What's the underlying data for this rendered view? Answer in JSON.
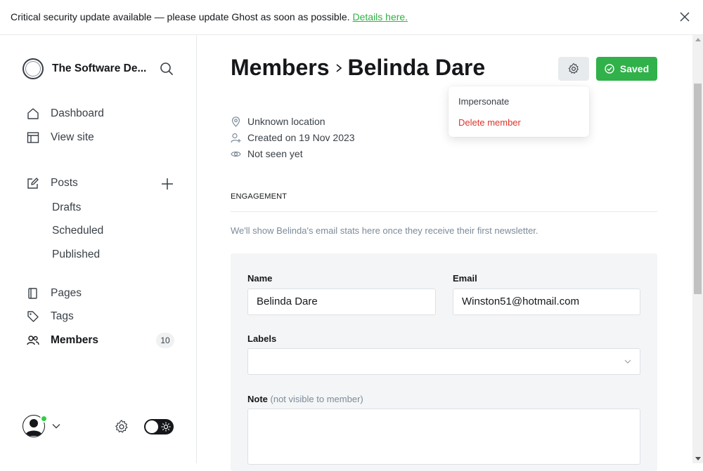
{
  "banner": {
    "text": "Critical security update available — please update Ghost as soon as possible.",
    "link": "Details here."
  },
  "sidebar": {
    "site_name": "The Software De...",
    "items": {
      "dashboard": "Dashboard",
      "view_site": "View site",
      "posts": "Posts",
      "drafts": "Drafts",
      "scheduled": "Scheduled",
      "published": "Published",
      "pages": "Pages",
      "tags": "Tags",
      "members": "Members"
    },
    "members_count": "10"
  },
  "header": {
    "breadcrumb_parent": "Members",
    "title": "Belinda Dare",
    "saved_label": "Saved"
  },
  "dropdown": {
    "impersonate": "Impersonate",
    "delete": "Delete member"
  },
  "meta": {
    "location": "Unknown location",
    "created": "Created on 19 Nov 2023",
    "seen": "Not seen yet"
  },
  "engagement": {
    "title": "ENGAGEMENT",
    "note": "We'll show Belinda's email stats here once they receive their first newsletter."
  },
  "form": {
    "name_label": "Name",
    "name_value": "Belinda Dare",
    "email_label": "Email",
    "email_value": "Winston51@hotmail.com",
    "labels_label": "Labels",
    "labels_value": "",
    "note_label": "Note",
    "note_hint": "(not visible to member)",
    "note_value": ""
  },
  "colors": {
    "accent_green": "#30b14a",
    "danger_red": "#e0342b",
    "online_dot": "#30cf43"
  }
}
